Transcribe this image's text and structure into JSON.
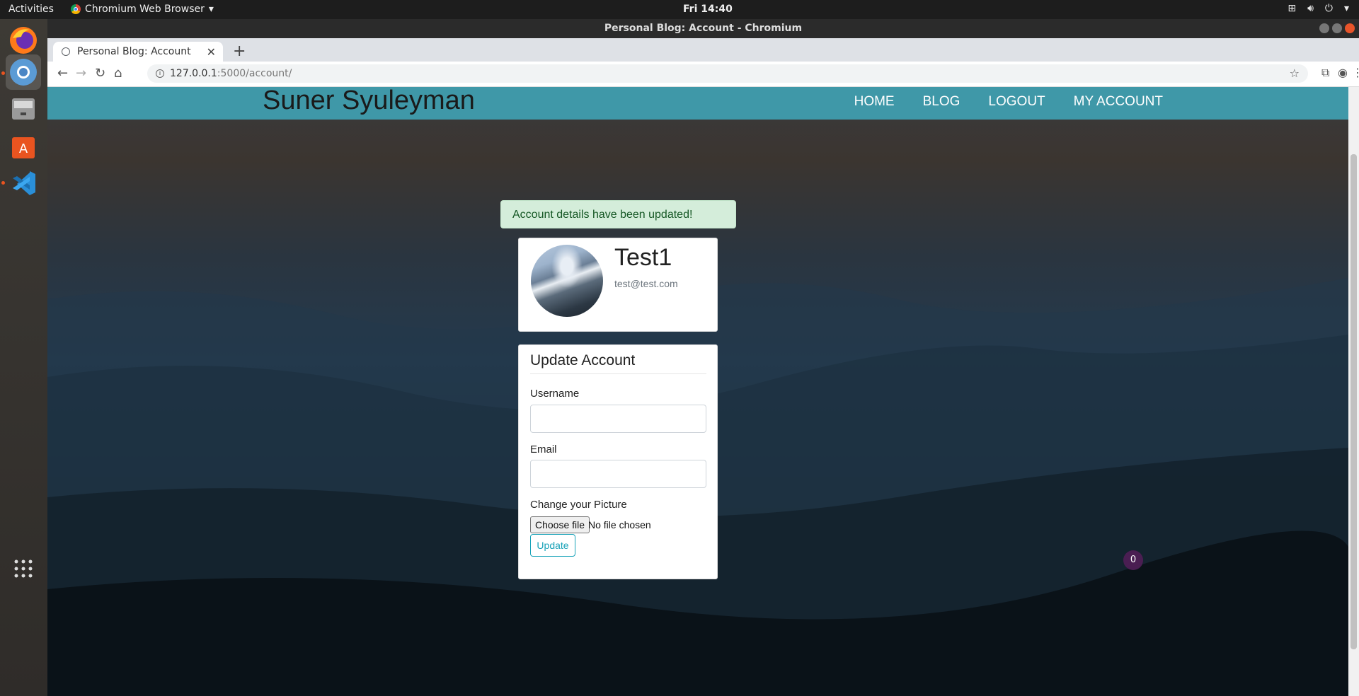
{
  "desktop": {
    "activities": "Activities",
    "app_menu": "Chromium Web Browser",
    "clock": "Fri 14:40"
  },
  "window": {
    "title": "Personal Blog: Account - Chromium"
  },
  "browser": {
    "tab_title": "Personal Blog: Account",
    "url_host": "127.0.0.1",
    "url_path": ":5000/account/"
  },
  "site": {
    "brand": "Suner Syuleyman",
    "nav": [
      "HOME",
      "BLOG",
      "LOGOUT",
      "MY ACCOUNT"
    ]
  },
  "alert": {
    "message": "Account details have been updated!"
  },
  "profile": {
    "name": "Test1",
    "email": "test@test.com"
  },
  "form": {
    "legend": "Update Account",
    "username_label": "Username",
    "username_value": "",
    "email_label": "Email",
    "email_value": "",
    "picture_label": "Change your Picture",
    "choose_file": "Choose file",
    "no_file": "No file chosen",
    "submit": "Update"
  },
  "badge_count": "0",
  "colors": {
    "navbar": "#3f98a8",
    "alert_bg": "#d4edda",
    "button_accent": "#17a2b8"
  }
}
